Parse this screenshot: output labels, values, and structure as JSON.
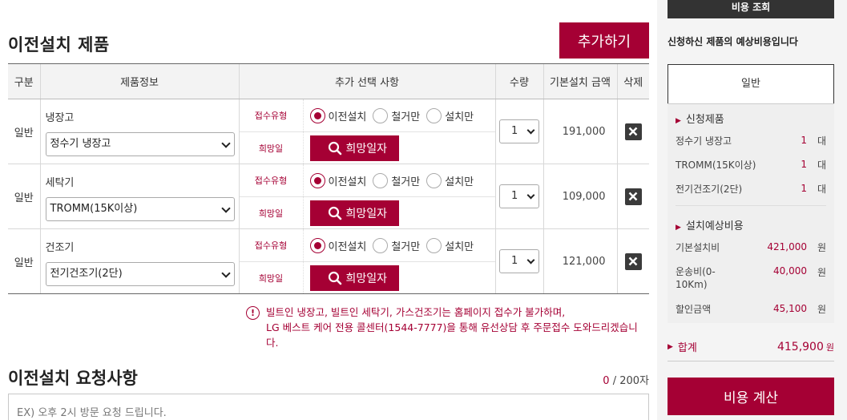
{
  "main": {
    "section_title": "이전설치 제품",
    "add_button": "추가하기",
    "headers": [
      "구분",
      "제품정보",
      "추가 선택 사항",
      "수량",
      "기본설치 금액",
      "삭제"
    ],
    "option_labels": {
      "reception": "접수유형",
      "date": "희망일"
    },
    "radio_options": [
      "이전설치",
      "철거만",
      "설치만"
    ],
    "date_button": "희망일자",
    "rows": [
      {
        "category": "일반",
        "name": "냉장고",
        "model": "정수기 냉장고",
        "qty": "1",
        "price": "191,000"
      },
      {
        "category": "일반",
        "name": "세탁기",
        "model": "TROMM(15K이상)",
        "qty": "1",
        "price": "109,000"
      },
      {
        "category": "일반",
        "name": "건조기",
        "model": "전기건조기(2단)",
        "qty": "1",
        "price": "121,000"
      }
    ],
    "notice": {
      "icon": "!",
      "line1": "빌트인 냉장고, 빌트인 세탁기, 가스건조기는 홈페이지 접수가 불가하며,",
      "line2": "LG 베스트 케어 전용 콜센터(1544-7777)을 통해 유선상담 후 주문접수 도와드리겠습니다."
    },
    "request": {
      "title": "이전설치 요청사항",
      "count_current": "0",
      "count_max": " / 200자",
      "placeholder": "EX) 오후 2시 방문 요청 드립니다."
    }
  },
  "side": {
    "header": "비용 조회",
    "subtitle": "신청하신 제품의 예상비용입니다",
    "tab": "일반",
    "products_title": "신청제품",
    "products": [
      {
        "name": "정수기 냉장고",
        "qty": "1",
        "unit": "대"
      },
      {
        "name": "TROMM(15K이상)",
        "qty": "1",
        "unit": "대"
      },
      {
        "name": "전기건조기(2단)",
        "qty": "1",
        "unit": "대"
      }
    ],
    "cost_title": "설치예상비용",
    "costs": [
      {
        "name": "기본설치비",
        "value": "421,000",
        "unit": "원"
      },
      {
        "name": "운송비(0-10Km)",
        "value": "40,000",
        "unit": "원"
      },
      {
        "name": "할인금액",
        "value": "45,100",
        "unit": "원"
      }
    ],
    "total_label": "합계",
    "total_value": "415,900",
    "total_unit": "원",
    "calc_button": "비용 계산"
  },
  "colors": {
    "accent": "#a50034",
    "dark": "#333333"
  }
}
